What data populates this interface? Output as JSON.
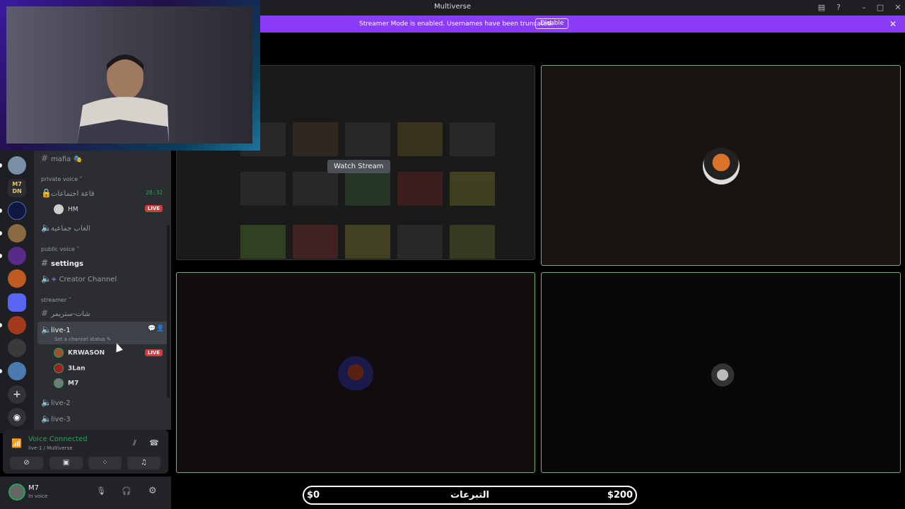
{
  "titlebar": {
    "title": "Multiverse"
  },
  "banner": {
    "text": "Streamer Mode is enabled. Usernames have been truncated.",
    "button": "Disable"
  },
  "channels": {
    "mafia": "mafia 🎭",
    "private_voice_cat": "private voice ˅",
    "meeting_room": "قاعة اجتماعات",
    "meeting_timer": "28:32",
    "meeting_user": "HM",
    "live_badge": "LIVE",
    "group_play": "العاب جماعية",
    "public_voice_cat": "public voice ˅",
    "settings": "settings",
    "creator_channel": "Creator Channel",
    "streamer_cat": "streamer ˅",
    "streamer_chat": "شات-ستريمر",
    "live1": "live-1",
    "live1_status": "Set a channel status ✎",
    "users": [
      "KRWASON",
      "3Lan",
      "M7"
    ],
    "live2": "live-2",
    "live3": "live-3"
  },
  "voice": {
    "status": "Voice Connected",
    "sub": "live-1 / Multiverse"
  },
  "user": {
    "name": "M7",
    "status": "In voice"
  },
  "servers": {
    "m7dn": "M7\nDN"
  },
  "stage": {
    "watch_label": "Watch Stream"
  },
  "donation": {
    "left": "$0",
    "label": "التبرعات",
    "right": "$200"
  },
  "colors": {
    "accent": "#8b3cf5",
    "live": "#da373c",
    "connected": "#23a55a",
    "tile_border": "#6fb57d"
  }
}
